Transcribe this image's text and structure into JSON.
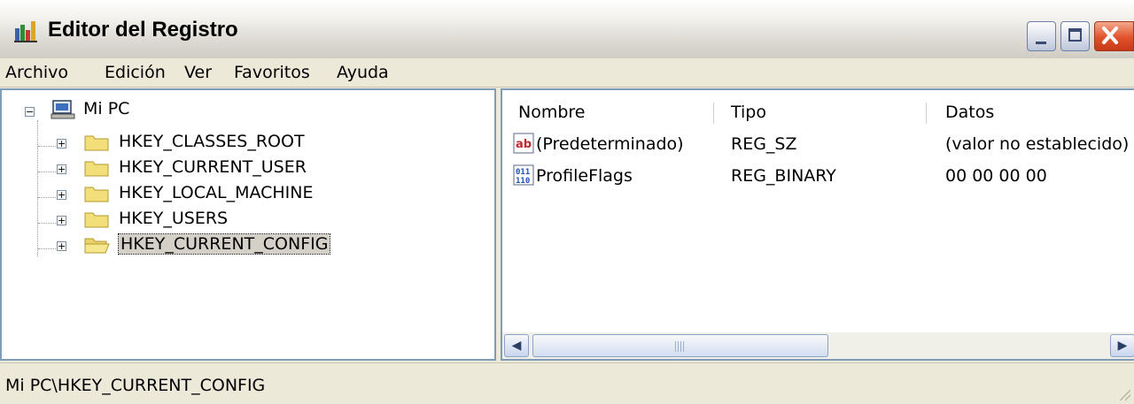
{
  "window": {
    "title": "Editor del Registro",
    "icon": "registry-editor-icon"
  },
  "menu": [
    "Archivo",
    "Edición",
    "Ver",
    "Favoritos",
    "Ayuda"
  ],
  "tree": {
    "root": "Mi PC",
    "root_icon": "computer-icon",
    "keys": [
      {
        "label": "HKEY_CLASSES_ROOT",
        "icon": "folder-icon"
      },
      {
        "label": "HKEY_CURRENT_USER",
        "icon": "folder-icon"
      },
      {
        "label": "HKEY_LOCAL_MACHINE",
        "icon": "folder-icon"
      },
      {
        "label": "HKEY_USERS",
        "icon": "folder-icon"
      },
      {
        "label": "HKEY_CURRENT_CONFIG",
        "icon": "folder-open-icon",
        "selected": true
      }
    ]
  },
  "list": {
    "columns": [
      "Nombre",
      "Tipo",
      "Datos"
    ],
    "rows": [
      {
        "name": "(Predeterminado)",
        "type": "REG_SZ",
        "data": "(valor no establecido)",
        "icon": "string-value-icon"
      },
      {
        "name": "ProfileFlags",
        "type": "REG_BINARY",
        "data": "00 00 00 00",
        "icon": "binary-value-icon"
      }
    ]
  },
  "status": {
    "path": "Mi PC\\HKEY_CURRENT_CONFIG"
  },
  "colors": {
    "close_button": "#e0532b",
    "pane_border": "#7f9db9",
    "chrome": "#ece9d8"
  }
}
